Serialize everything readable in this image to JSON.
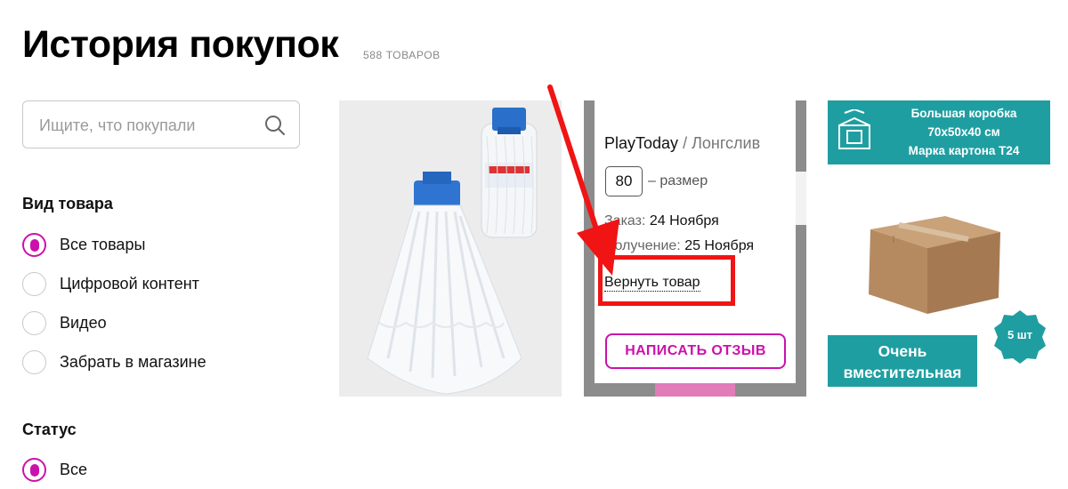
{
  "page": {
    "title": "История покупок",
    "count": "588 ТОВАРОВ"
  },
  "search": {
    "placeholder": "Ищите, что покупали"
  },
  "filters": {
    "product_type": {
      "heading": "Вид товара",
      "options": [
        {
          "label": "Все товары",
          "checked": true
        },
        {
          "label": "Цифровой контент",
          "checked": false
        },
        {
          "label": "Видео",
          "checked": false
        },
        {
          "label": "Забрать в магазине",
          "checked": false
        }
      ]
    },
    "status": {
      "heading": "Статус",
      "options": [
        {
          "label": "Все",
          "checked": true
        }
      ]
    }
  },
  "products": [
    {
      "kind": "photo",
      "icon": "mop-icon"
    },
    {
      "brand": "PlayToday",
      "separator": " / ",
      "name": "Лонгслив",
      "size": "80",
      "size_note": "– размер",
      "order_label": "Заказ:",
      "order_date": "24 Ноября",
      "receive_label": "Получение:",
      "receive_date": "25 Ноября",
      "return_label": "Вернуть товар",
      "review_label": "НАПИСАТЬ ОТЗЫВ"
    },
    {
      "banner_text": "Большая коробка\n70x50x40 см\nМарка картона Т24",
      "footer_text": "Очень\nвместительная",
      "badge_text": "5 шт",
      "icon": "box-icon"
    }
  ],
  "colors": {
    "accent": "#cb11ab",
    "annotation_red": "#f01414",
    "teal": "#1f9ea1"
  }
}
